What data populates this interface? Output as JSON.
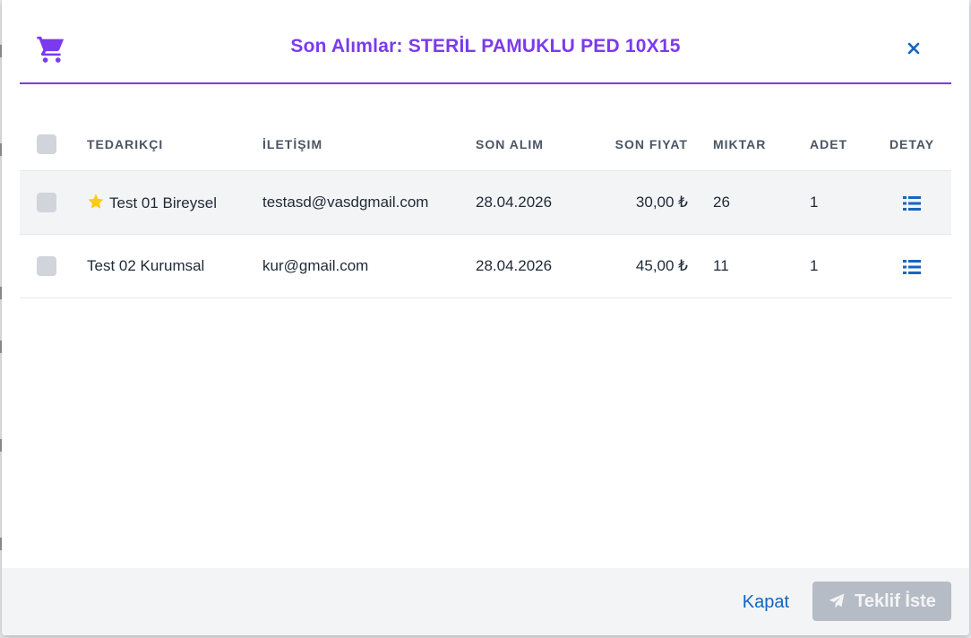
{
  "colors": {
    "accent": "#7c3aed",
    "link": "#1565c0",
    "star": "#facc15"
  },
  "modal": {
    "title": "Son Alımlar: STERİL PAMUKLU PED 10X15",
    "icons": {
      "header": "shopping-cart-icon",
      "close": "close-icon"
    }
  },
  "table": {
    "headers": {
      "supplier": "TEDARIKÇI",
      "contact": "İLETİŞIM",
      "last_purchase": "SON ALIM",
      "last_price": "SON FIYAT",
      "quantity": "MIKTAR",
      "count": "ADET",
      "detail": "DETAY"
    },
    "rows": [
      {
        "favorite": true,
        "supplier": "Test 01 Bireysel",
        "contact": "testasd@vasdgmail.com",
        "last_purchase": "28.04.2026",
        "last_price": "30,00 ₺",
        "quantity": "26",
        "count": "1",
        "detail_icon": "list-icon"
      },
      {
        "favorite": false,
        "supplier": "Test 02 Kurumsal",
        "contact": "kur@gmail.com",
        "last_purchase": "28.04.2026",
        "last_price": "45,00 ₺",
        "quantity": "11",
        "count": "1",
        "detail_icon": "list-icon"
      }
    ]
  },
  "footer": {
    "close_label": "Kapat",
    "request_label": "Teklif İste",
    "request_icon": "paper-plane-icon"
  }
}
